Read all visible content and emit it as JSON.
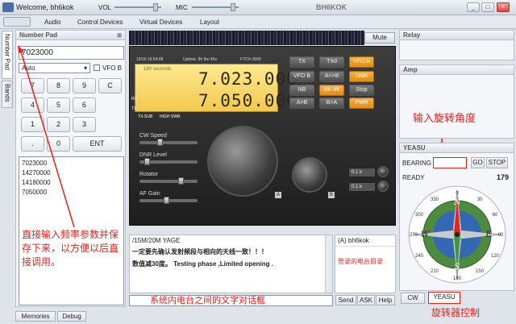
{
  "titlebar": {
    "welcome": "Welcome, bh6kok",
    "vol_label": "VOL",
    "mic_label": "MIC",
    "app_title": "BH6KOK",
    "min": "_",
    "max": "□",
    "close": "×"
  },
  "menu": [
    "Audio",
    "Control Devices",
    "Virtual Devices",
    "Layout"
  ],
  "side_tabs": {
    "number_pad": "Number Pad",
    "bands": "Bands"
  },
  "number_pad": {
    "title": "Number Pad",
    "freq_value": "7023000",
    "mode_value": "Auto",
    "vfo_b_label": "VFO B",
    "keys": [
      "7",
      "8",
      "9",
      "C",
      "4",
      "5",
      "6",
      "1",
      "2",
      "3",
      ".",
      "0",
      "ENT"
    ],
    "memory_list": [
      "7023000",
      "14270000",
      "14180000",
      "7050000"
    ]
  },
  "annotations": {
    "left": "直接输入频率参数并保存下来，以方便以后直接调用。",
    "bearing": "输入旋转角度",
    "chat": "系统内电台之间的文字对话框",
    "rotator": "旋转器控制",
    "users": "登录的电台目录"
  },
  "waterfall": {
    "mute": "Mute"
  },
  "radio": {
    "model": "FTDX-3000",
    "date": "10/16 16:54:08",
    "uptime": "Uptime: 9h 9m 45s",
    "hint": "180 seconds.",
    "freq_a": "7.023.000",
    "freq_b": "7.050.000",
    "rx": "RX",
    "tx": "TX",
    "tx_sub": "TX-SUB",
    "high_swr": "HIGH SWR",
    "buttons": [
      "TX",
      "TXd",
      "VFO A",
      "VFO B",
      "A<>B",
      "DNR",
      "NB",
      "BK-IN",
      "Stop",
      "A>B",
      "B>A",
      "PWR"
    ],
    "sliders": [
      "CW Speed",
      "DNR Level",
      "Rotator",
      "AF Gain"
    ],
    "step1": "0.1 k",
    "step2": "0.1 k",
    "badge_a": "A",
    "badge_b": "B"
  },
  "chat": {
    "line1": "/15M/20M YAGE",
    "line2": "一定要先确认发射频段与相向的天线一致！！！",
    "line3": "数值减30度。 Testing phase ,Limited opening .",
    "send": "Send",
    "ask": "ASK",
    "help": "Help"
  },
  "users": {
    "item": "(A) bh6kok"
  },
  "relay": {
    "title": "Relay"
  },
  "amp": {
    "title": "Amp"
  },
  "yeasu": {
    "title": "YEASU",
    "bearing_label": "BEARING",
    "bearing_value": "",
    "go": "GO",
    "stop": "STOP",
    "ready": "READY",
    "heading": "179",
    "compass": {
      "n": "N",
      "s": "S",
      "e": "E",
      "w": "W",
      "t0": "0",
      "t30": "30",
      "t60": "60",
      "t90": "90",
      "t120": "120",
      "t150": "150",
      "t180": "180",
      "t210": "210",
      "t240": "240",
      "t270": "270",
      "t300": "300",
      "t330": "330"
    }
  },
  "bottom_tabs": {
    "memories": "Memories",
    "debug": "Debug",
    "cw": "CW",
    "yeasu": "YEASU"
  }
}
